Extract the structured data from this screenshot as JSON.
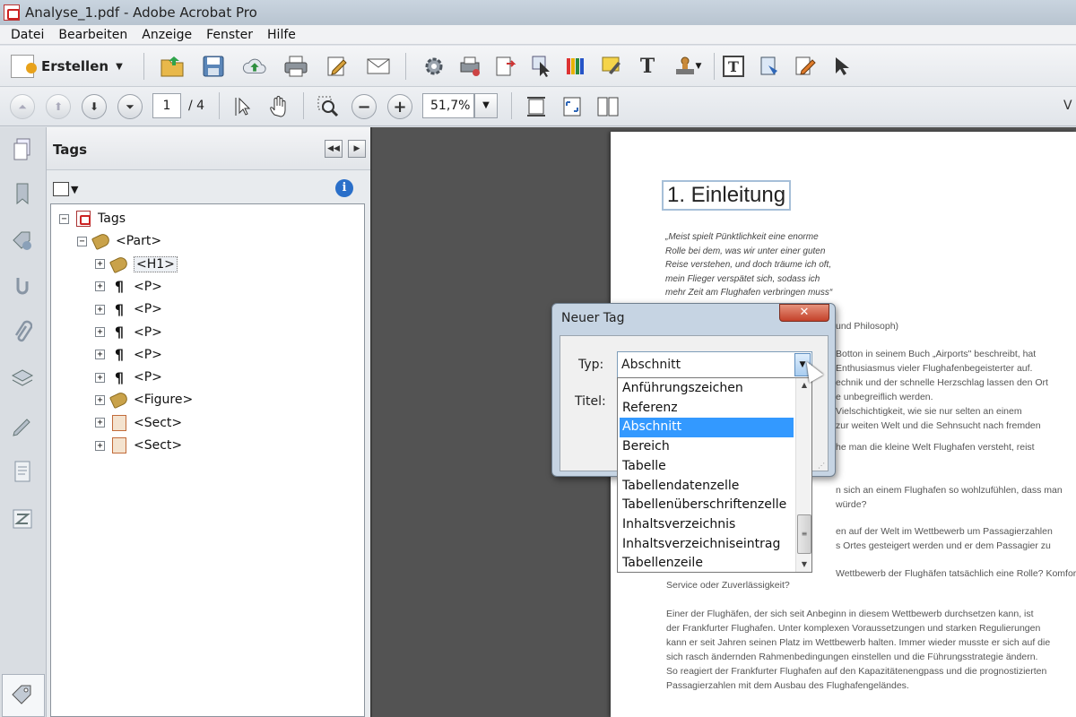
{
  "window": {
    "title": "Analyse_1.pdf - Adobe Acrobat Pro"
  },
  "menu": [
    "Datei",
    "Bearbeiten",
    "Anzeige",
    "Fenster",
    "Hilfe"
  ],
  "toolbar": {
    "create_label": "Erstellen"
  },
  "nav": {
    "current_page": "1",
    "page_total": "/ 4",
    "zoom": "51,7%",
    "right_clip": "V"
  },
  "tags_panel": {
    "title": "Tags",
    "tree": [
      {
        "label": "Tags",
        "icon": "pdf-icon",
        "expander": "⊟"
      },
      {
        "label": "<Part>",
        "icon": "tag-icon",
        "expander": "⊟"
      },
      {
        "label": "<H1>",
        "icon": "tag-icon",
        "expander": "⊞",
        "selected": true
      },
      {
        "label": "<P>",
        "icon": "paragraph-icon",
        "expander": "⊞"
      },
      {
        "label": "<P>",
        "icon": "paragraph-icon",
        "expander": "⊞"
      },
      {
        "label": "<P>",
        "icon": "paragraph-icon",
        "expander": "⊞"
      },
      {
        "label": "<P>",
        "icon": "paragraph-icon",
        "expander": "⊞"
      },
      {
        "label": "<P>",
        "icon": "paragraph-icon",
        "expander": "⊞"
      },
      {
        "label": "<Figure>",
        "icon": "tag-icon",
        "expander": "⊞"
      },
      {
        "label": "<Sect>",
        "icon": "section-icon",
        "expander": "⊞"
      },
      {
        "label": "<Sect>",
        "icon": "section-icon",
        "expander": "⊞"
      }
    ]
  },
  "document": {
    "heading": "1. Einleitung",
    "quote_lines": [
      "„Meist spielt Pünktlichkeit eine enorme",
      "Rolle bei dem, was wir unter einer guten",
      "Reise verstehen, und doch träume ich oft,",
      "mein Flieger verspätet sich, sodass ich",
      "mehr Zeit am Flughafen verbringen muss“"
    ],
    "right_fragments": [
      "und Philosoph)",
      "Botton in seinem Buch „Airports\" beschreibt, hat",
      "Enthusiasmus vieler Flughafenbegeisterter auf.",
      "echnik und der schnelle Herzschlag lassen den Ort",
      "e unbegreiflich werden.",
      "Vielschichtigkeit, wie sie nur selten an einem",
      "zur weiten Welt und die Sehnsucht nach fremden",
      "he man die kleine Welt Flughafen versteht, reist",
      "n sich an einem Flughafen so wohlzufühlen, dass man",
      "würde?",
      "en auf der Welt im Wettbewerb um Passagierzahlen",
      "s Ortes gesteigert werden und er dem Passagier zu",
      "Wettbewerb der Flughäfen tatsächlich eine Rolle? Komfort,"
    ],
    "body_lines": [
      "Service oder Zuverlässigkeit?",
      "Einer der Flughäfen, der sich seit Anbeginn in diesem Wettbewerb durchsetzen kann, ist",
      "der Frankfurter Flughafen. Unter komplexen Voraussetzungen und starken Regulierungen",
      "kann er seit Jahren seinen Platz im Wettbewerb halten. Immer wieder musste er sich auf die",
      "sich rasch ändernden Rahmenbedingungen einstellen und die Führungsstrategie ändern.",
      "So reagiert der Frankfurter Flughafen auf den Kapazitätenengpass und die prognostizierten",
      "Passagierzahlen mit dem Ausbau des Flughafengeländes."
    ]
  },
  "dialog": {
    "title": "Neuer Tag",
    "close": "✕",
    "type_label": "Typ:",
    "title_label": "Titel:",
    "selected_type": "Abschnitt",
    "options": [
      "Anführungszeichen",
      "Referenz",
      "Abschnitt",
      "Bereich",
      "Tabelle",
      "Tabellendatenzelle",
      "Tabellenüberschriftenzelle",
      "Inhaltsverzeichnis",
      "Inhaltsverzeichniseintrag",
      "Tabellenzeile"
    ]
  }
}
